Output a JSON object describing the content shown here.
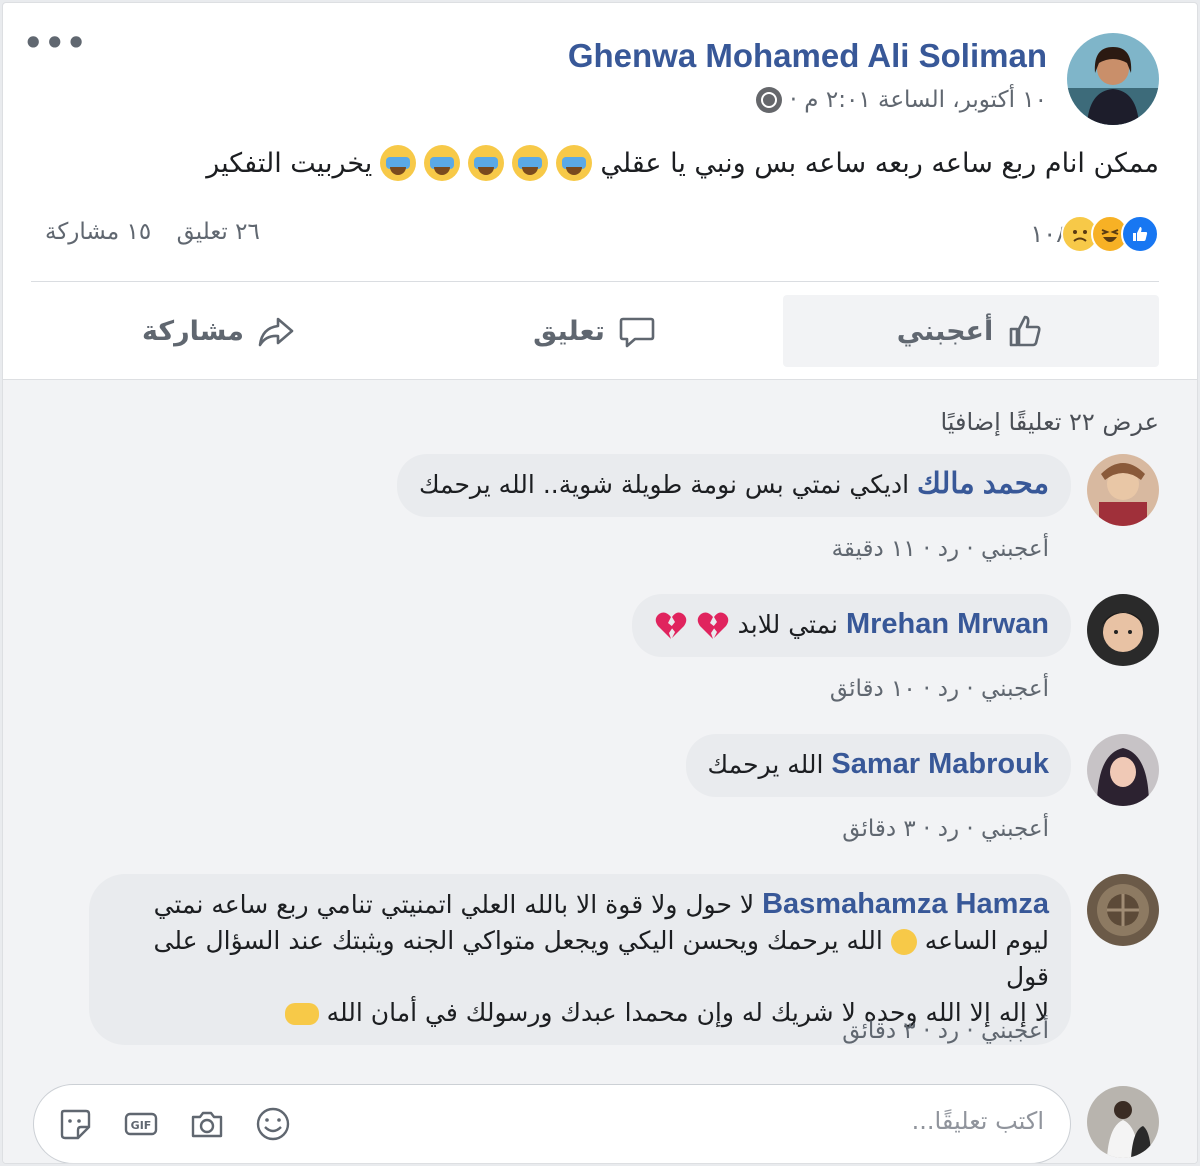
{
  "post": {
    "author": "Ghenwa Mohamed Ali Soliman",
    "meta": "١٠ أكتوبر، الساعة ٢:٠١ م ·",
    "text": "ممكن انام ربع ساعه ربعه ساعه بس ونبي يا عقلي",
    "text_tail": "يخربيت التفكير",
    "reaction_count": "١٠٨",
    "comments_count": "٢٦ تعليق",
    "shares_count": "١٥ مشاركة"
  },
  "actions": {
    "like": "أعجبني",
    "comment": "تعليق",
    "share": "مشاركة"
  },
  "comments_section": {
    "more_label": "عرض ٢٢ تعليقًا إضافيًا",
    "items": [
      {
        "name": "محمد مالك",
        "text": "اديكي نمتي بس نومة طويلة شوية.. الله يرحمك",
        "actions": "أعجبني · رد · ١١ دقيقة"
      },
      {
        "name": "Mrehan Mrwan",
        "text": "نمتي للابد",
        "actions": "أعجبني · رد · ١٠ دقائق"
      },
      {
        "name": "Samar Mabrouk",
        "text": "الله يرحمك",
        "actions": "أعجبني · رد · ٣ دقائق"
      },
      {
        "name": "Basmahamza Hamza",
        "text1": "لا حول ولا قوة الا بالله العلي اتمنيتي تنامي ربع ساعه نمتي",
        "text2": "ليوم الساعه",
        "text2b": "الله يرحمك ويحسن اليكي ويجعل متواكي الجنه ويثبتك عند السؤال على قول",
        "text3": "لا إله إلا الله وحده لا شريك له وإن محمدا عبدك ورسولك في أمان الله",
        "actions": "أعجبني · رد · ٣ دقائق"
      }
    ],
    "write_placeholder": "اكتب تعليقًا..."
  },
  "colors": {
    "link": "#385898",
    "like": "#1877f2",
    "bubble": "#e9ebee"
  },
  "icons": [
    "globe-icon",
    "more-dots-icon",
    "like-reaction-icon",
    "haha-reaction-icon",
    "sad-reaction-icon",
    "thumbs-up-icon",
    "comment-icon",
    "share-icon",
    "sticker-icon",
    "gif-icon",
    "camera-icon",
    "smiley-icon",
    "broken-heart-icon",
    "crying-face-icon"
  ]
}
